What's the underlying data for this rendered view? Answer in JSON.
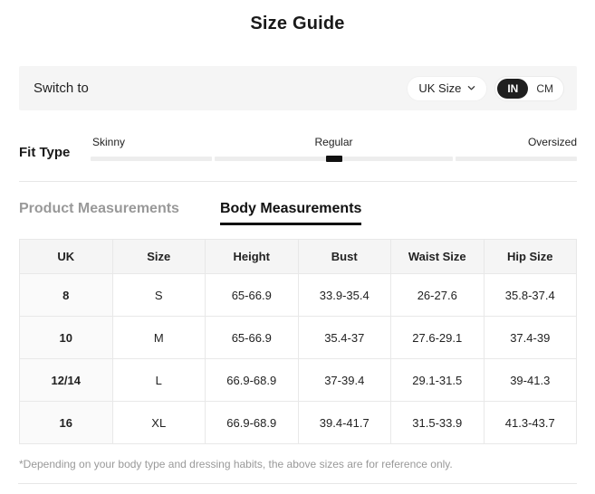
{
  "title": "Size Guide",
  "switch_bar": {
    "label": "Switch to",
    "size_dropdown": {
      "value": "UK Size"
    },
    "unit_toggle": {
      "options": [
        "IN",
        "CM"
      ],
      "selected": "IN"
    }
  },
  "fit_type": {
    "label": "Fit Type",
    "options": [
      "Skinny",
      "Regular",
      "Oversized"
    ],
    "selected": "Regular"
  },
  "tabs": [
    {
      "label": "Product Measurements",
      "active": false
    },
    {
      "label": "Body Measurements",
      "active": true
    }
  ],
  "table": {
    "headers": [
      "UK",
      "Size",
      "Height",
      "Bust",
      "Waist Size",
      "Hip Size"
    ],
    "rows": [
      [
        "8",
        "S",
        "65-66.9",
        "33.9-35.4",
        "26-27.6",
        "35.8-37.4"
      ],
      [
        "10",
        "M",
        "65-66.9",
        "35.4-37",
        "27.6-29.1",
        "37.4-39"
      ],
      [
        "12/14",
        "L",
        "66.9-68.9",
        "37-39.4",
        "29.1-31.5",
        "39-41.3"
      ],
      [
        "16",
        "XL",
        "66.9-68.9",
        "39.4-41.7",
        "31.5-33.9",
        "41.3-43.7"
      ]
    ]
  },
  "footnote": "*Depending on your body type and dressing habits, the above sizes are for reference only.",
  "colors": {
    "accent_dark": "#1f1f1f",
    "bar_background": "#f5f5f5",
    "muted_text": "#999999",
    "table_border": "#e8e8e8"
  }
}
